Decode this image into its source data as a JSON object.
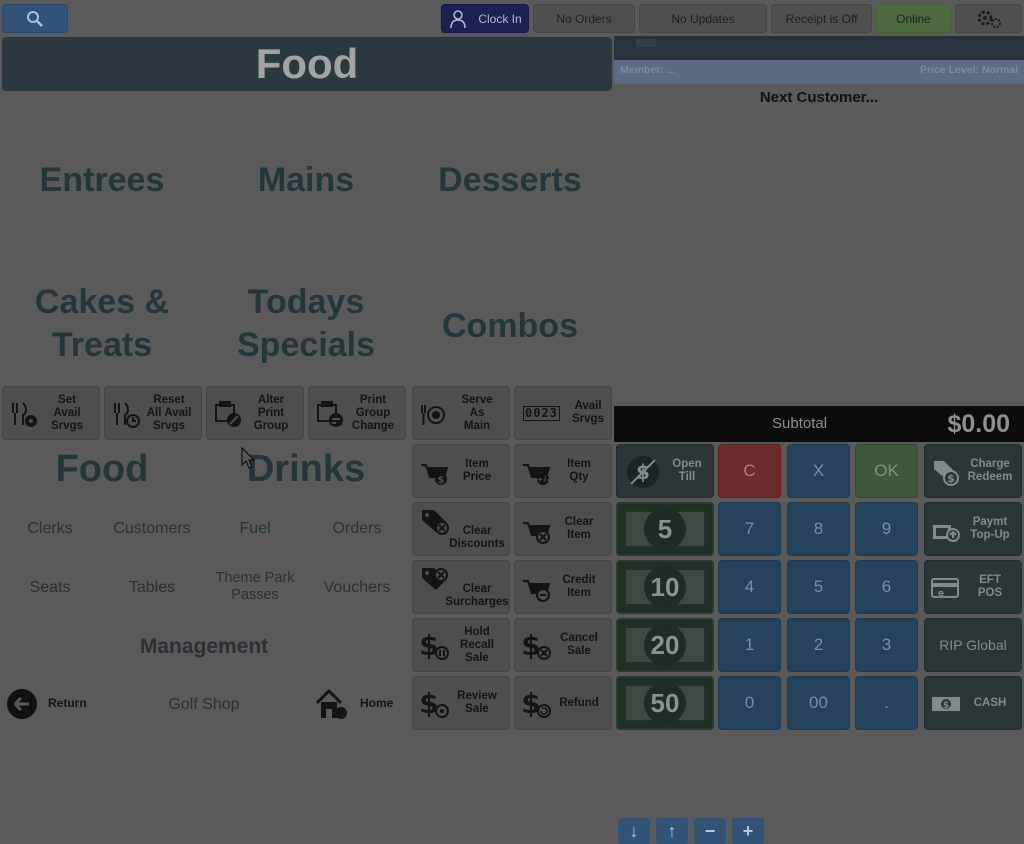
{
  "topbar": {
    "clock_in": "Clock In",
    "orders": "No Orders",
    "updates": "No Updates",
    "receipt": "Receipt is Off",
    "online": "Online"
  },
  "header": {
    "title": "Food"
  },
  "categories": {
    "entrees": "Entrees",
    "mains": "Mains",
    "desserts": "Desserts",
    "cakes_line1": "Cakes &",
    "cakes_line2": "Treats",
    "specials_line1": "Todays",
    "specials_line2": "Specials",
    "combos": "Combos"
  },
  "functions": {
    "set_avail": "Set\nAvail\nSrvgs",
    "reset_avail": "Reset\nAll Avail\nSrvgs",
    "alter_print": "Alter\nPrint\nGroup",
    "print_group_change": "Print\nGroup\nChange",
    "serve_as_main": "Serve\nAs\nMain",
    "avail_srvgs": "Avail\nSrvgs",
    "item_price": "Item\nPrice",
    "item_qty": "Item\nQty",
    "clear_discounts": "Clear\nDiscounts",
    "clear_item": "Clear\nItem",
    "clear_surcharges": "Clear\nSurcharges",
    "credit_item": "Credit\nItem",
    "hold_recall": "Hold\nRecall\nSale",
    "cancel_sale": "Cancel\nSale",
    "review_sale": "Review\nSale",
    "refund": "Refund",
    "counter_digits": "0023"
  },
  "groups": {
    "food": "Food",
    "drinks": "Drinks"
  },
  "nav": {
    "clerks": "Clerks",
    "customers": "Customers",
    "fuel": "Fuel",
    "orders": "Orders",
    "seats": "Seats",
    "tables": "Tables",
    "theme_park_1": "Theme Park",
    "theme_park_2": "Passes",
    "vouchers": "Vouchers",
    "management": "Management",
    "return": "Return",
    "golf_shop": "Golf Shop",
    "home": "Home"
  },
  "sale": {
    "member": "Member: ...",
    "price_level": "Price Level: Normal",
    "next_customer": "Next Customer...",
    "subtotal_label": "Subtotal",
    "subtotal_value": "$0.00"
  },
  "keypad": {
    "open_till": "Open\nTill",
    "c": "C",
    "x": "X",
    "ok": "OK",
    "charge_redeem": "Charge\nRedeem",
    "k7": "7",
    "k8": "8",
    "k9": "9",
    "k4": "4",
    "k5": "5",
    "k6": "6",
    "k1": "1",
    "k2": "2",
    "k3": "3",
    "k0": "0",
    "k00": "00",
    "kdot": ".",
    "paymt_topup": "Paymt\nTop-Up",
    "eft_pos": "EFT\nPOS",
    "rip_global": "RIP Global",
    "cash": "CASH"
  },
  "cash_notes": [
    "5",
    "10",
    "20",
    "50"
  ],
  "colors": {
    "search": "#2f5478",
    "clock_in": "#1b2150",
    "online": "#4d6b3c",
    "clear_key": "#8a3030",
    "ok_key": "#4b6f44",
    "numpad": "#24445e"
  }
}
